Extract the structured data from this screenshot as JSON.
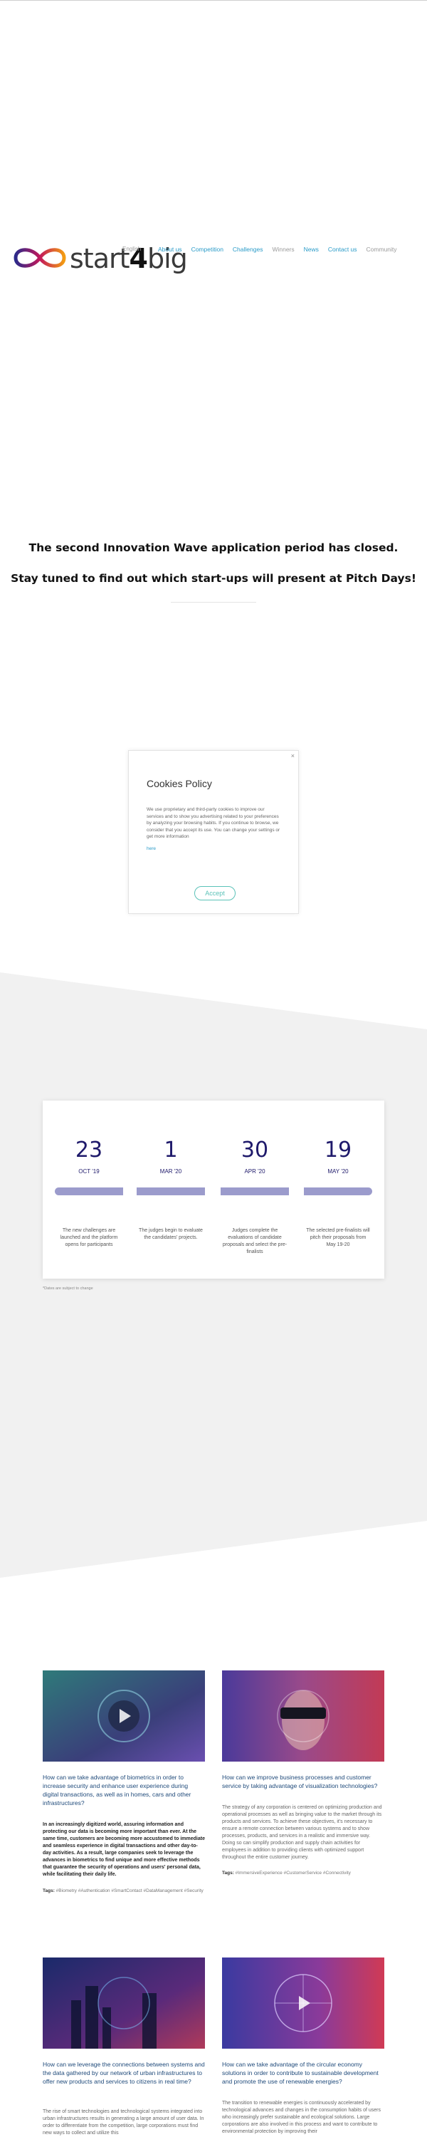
{
  "header": {
    "logo_prefix": "start",
    "logo_digit": "4",
    "logo_suffix": "big",
    "language": "English",
    "nav": [
      "About us",
      "Competition",
      "Challenges",
      "Winners",
      "News",
      "Contact us",
      "Community"
    ]
  },
  "hero": {
    "title": "The second Innovation Wave application period has closed.",
    "subtitle": "Stay tuned to find out which start-ups will present at Pitch Days!"
  },
  "cookie": {
    "close": "×",
    "title": "Cookies Policy",
    "body": "We use proprietary and third-party cookies to improve our services and to show you advertising related to your preferences by analyzing your browsing habits. If you continue to browse, we consider that you accept its use. You can change your settings or get more information",
    "link": "here",
    "accept": "Accept"
  },
  "timeline": {
    "steps": [
      {
        "day": "23",
        "month": "OCT '19",
        "desc": "The new challenges are launched and the platform opens for participants"
      },
      {
        "day": "1",
        "month": "MAR '20",
        "desc": "The judges begin to evaluate the candidates' projects."
      },
      {
        "day": "30",
        "month": "APR '20",
        "desc": "Judges complete the evaluations of candidate proposals and select the pre-finalists"
      },
      {
        "day": "19",
        "month": "MAY '20",
        "desc": "The selected pre-finalists will pitch their proposals from May 19-20"
      }
    ],
    "note": "*Dates are subject to change"
  },
  "articles": [
    {
      "title": "How can we take advantage of biometrics in order to increase security and enhance user experience during digital transactions, as well as in homes, cars and other infrastructures?",
      "body": "In an increasingly digitized world, assuring information and protecting our data is becoming more important than ever. At the same time, customers are becoming more accustomed to immediate and seamless experience in digital transactions and other day-to-day activities. As a result, large companies seek to leverage the advances in biometrics to find unique and more effective methods that guarantee the security of operations and users' personal data, while facilitating their daily life.",
      "tags_label": "Tags:",
      "tags": "#Biometry #Authentication #SmartContact #DataManagement #Security"
    },
    {
      "title": "How can we improve business processes and customer service by taking advantage of visualization technologies?",
      "body": "The strategy of any corporation is centered on optimizing production and operational processes as well as bringing value to the market through its products and services. To achieve these objectives, it's necessary to ensure a remote connection between various systems and to show processes, products, and services in a realistic and immersive way. Doing so can simplify production and supply chain activities for employees in addition to providing clients with optimized support throughout the entire customer journey.",
      "tags_label": "Tags:",
      "tags": "#ImmersiveExperience #CustomerService #Connectivity"
    },
    {
      "title": "How can we leverage the connections between systems and the data gathered by our network of urban infrastructures to offer new products and services to citizens in real time?",
      "body": "The rise of smart technologies and technological systems integrated into urban infrastructures results in generating a large amount of user data. In order to differentiate from the competition, large corporations must find new ways to collect and utilize this",
      "tags_label": "",
      "tags": ""
    },
    {
      "title": "How can we take advantage of the circular economy solutions in order to contribute to sustainable development and promote the use of renewable energies?",
      "body": "The transition to renewable energies is continuously accelerated by technological advances and changes in the consumption habits of users who increasingly prefer sustainable and ecological solutions. Large corporations are also involved in this process and want to contribute to environmental protection by improving their",
      "tags_label": "",
      "tags": ""
    }
  ],
  "colors": {
    "nav_link": "#2a9bc8",
    "timeline_number": "#1f1a6b",
    "timeline_bar": "#9b9bcc",
    "accept_button": "#5bc2b8",
    "grey_section": "#f1f1f1"
  }
}
